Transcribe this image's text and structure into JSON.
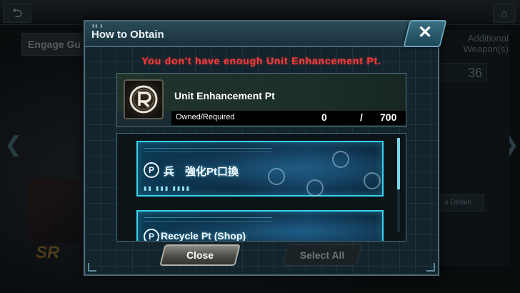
{
  "background": {
    "engage_tab": "Engage Gu",
    "weapons_label": "Additional Weapon(s)",
    "value_36": "36",
    "obtain_button": "o Obtain"
  },
  "dialog": {
    "title": "How to Obtain",
    "close_glyph": "✕",
    "warning": "You don't have enough Unit Enhancement Pt.",
    "item": {
      "name": "Unit Enhancement Pt",
      "owned_label": "Owned/Required",
      "owned": "0",
      "slash": "/",
      "required": "700"
    },
    "sources": [
      {
        "title": "兵　強化Pt口換"
      },
      {
        "title": "Recycle Pt (Shop)"
      }
    ],
    "buttons": {
      "close": "Close",
      "select_all": "Select All"
    }
  },
  "colors": {
    "warning": "#ff3b3b",
    "banner_border": "#39d1ee",
    "header": "#2a4a58"
  }
}
